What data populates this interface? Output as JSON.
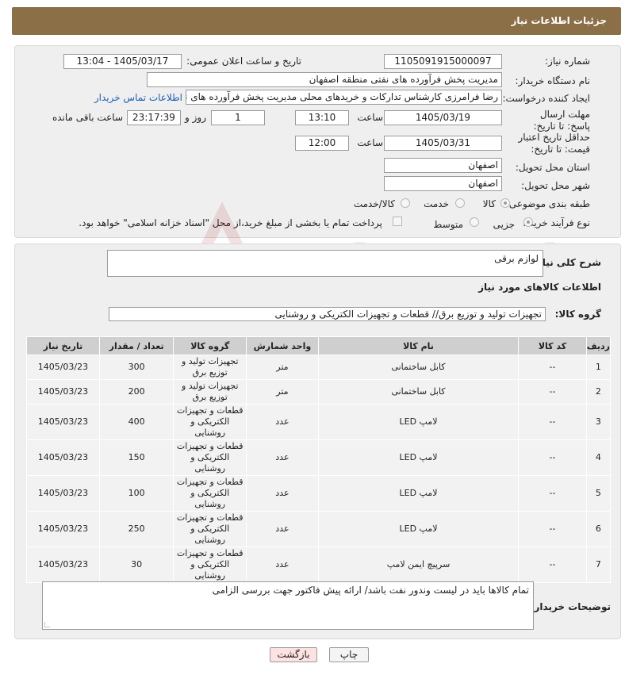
{
  "header": {
    "title": "جزئیات اطلاعات نیاز"
  },
  "form": {
    "need_number_label": "شماره نیاز:",
    "need_number": "1105091915000097",
    "announce_label": "تاریخ و ساعت اعلان عمومی:",
    "announce_value": "1405/03/17 - 13:04",
    "buyer_org_label": "نام دستگاه خریدار:",
    "buyer_org": "مدیریت پخش فرآورده های نفتی منطقه اصفهان",
    "creator_label": "ایجاد کننده درخواست:",
    "creator": "رضا فرامرزی کارشناس تدارکات و خریدهای محلی مدیریت پخش فرآورده های نفت",
    "contact_link": "اطلاعات تماس خریدار",
    "deadline_label": "مهلت ارسال پاسخ: تا تاریخ:",
    "deadline_date": "1405/03/19",
    "time_label": "ساعت",
    "deadline_time": "13:10",
    "days_value": "1",
    "days_label": "روز و",
    "remaining_time": "23:17:39",
    "remaining_label": "ساعت باقی مانده",
    "min_validity_label": "حداقل تاریخ اعتبار قیمت: تا تاریخ:",
    "validity_date": "1405/03/31",
    "validity_time": "12:00",
    "province_label": "استان محل تحویل:",
    "province": "اصفهان",
    "city_label": "شهر محل تحویل:",
    "city": "اصفهان",
    "category_label": "طبقه بندی موضوعی:",
    "category_options": [
      "کالا",
      "خدمت",
      "کالا/خدمت"
    ],
    "process_label": "نوع فرآیند خرید :",
    "process_options": [
      "جزیی",
      "متوسط"
    ],
    "payment_note": "پرداخت تمام یا بخشی از مبلغ خرید،از محل \"اسناد خزانه اسلامی\" خواهد بود."
  },
  "summary": {
    "description_label": "شرح کلی نیاز:",
    "description": "لوازم برقی",
    "goods_info_title": "اطلاعات کالاهای مورد نیاز",
    "goods_group_label": "گروه کالا:",
    "goods_group": "تجهیزات تولید و توزیع برق// قطعات و تجهیزات الکتریکی و روشنایی"
  },
  "table": {
    "headers": [
      "ردیف",
      "کد کالا",
      "نام کالا",
      "واحد شمارش",
      "گروه کالا",
      "تعداد / مقدار",
      "تاریخ نیاز"
    ],
    "rows": [
      [
        "1",
        "--",
        "کابل ساختمانی",
        "متر",
        "تجهیزات تولید و توزیع برق",
        "300",
        "1405/03/23"
      ],
      [
        "2",
        "--",
        "کابل ساختمانی",
        "متر",
        "تجهیزات تولید و توزیع برق",
        "200",
        "1405/03/23"
      ],
      [
        "3",
        "--",
        "لامپ LED",
        "عدد",
        "قطعات و تجهیزات الکتریکی و روشنایی",
        "400",
        "1405/03/23"
      ],
      [
        "4",
        "--",
        "لامپ LED",
        "عدد",
        "قطعات و تجهیزات الکتریکی و روشنایی",
        "150",
        "1405/03/23"
      ],
      [
        "5",
        "--",
        "لامپ LED",
        "عدد",
        "قطعات و تجهیزات الکتریکی و روشنایی",
        "100",
        "1405/03/23"
      ],
      [
        "6",
        "--",
        "لامپ LED",
        "عدد",
        "قطعات و تجهیزات الکتریکی و روشنایی",
        "250",
        "1405/03/23"
      ],
      [
        "7",
        "--",
        "سرپیچ ایمن لامپ",
        "عدد",
        "قطعات و تجهیزات الکتریکی و روشنایی",
        "30",
        "1405/03/23"
      ]
    ]
  },
  "notes": {
    "label": "توضیحات خریدار:",
    "text": "تمام کالاها باید در لیست وندور نفت باشد/ ارائه پیش فاکتور جهت بررسی الزامی"
  },
  "buttons": {
    "print": "چاپ",
    "back": "بازگشت"
  },
  "watermark": {
    "text": "AriaTender.net"
  }
}
